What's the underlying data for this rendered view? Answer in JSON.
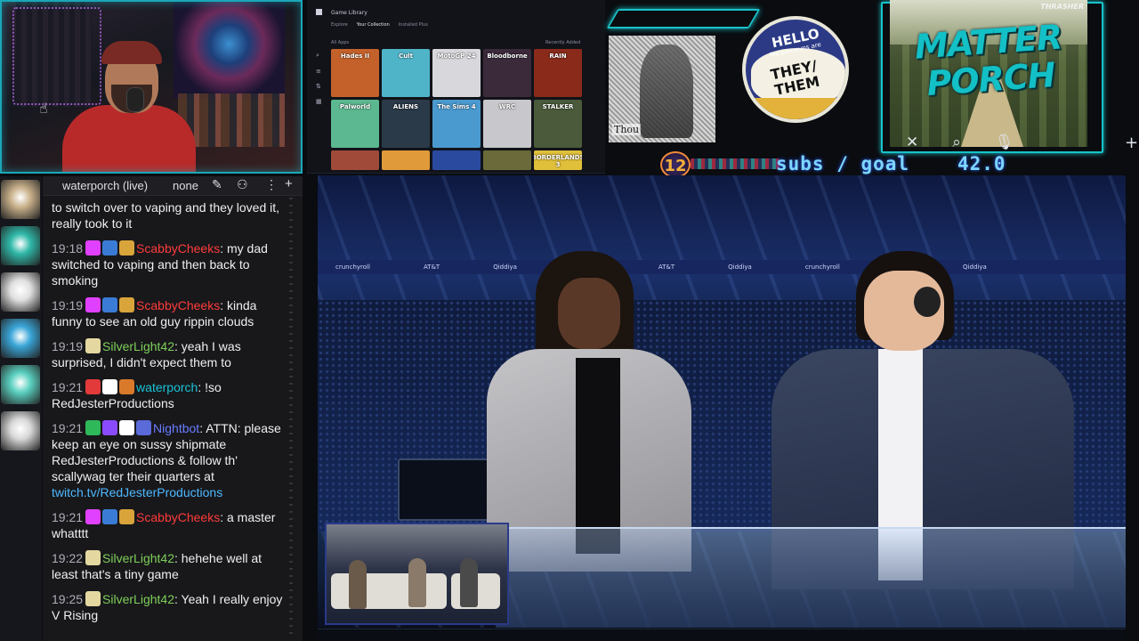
{
  "library": {
    "title": "Game Library",
    "tabs": [
      "Explore",
      "Your Collection",
      "Installed Plus"
    ],
    "all_label": "All Apps",
    "recent_label": "Recently Added",
    "tiles": [
      {
        "label": "Hades II",
        "color": "#c4612a"
      },
      {
        "label": "Cult",
        "color": "#4fb4c8"
      },
      {
        "label": "MotoGP 24",
        "color": "#d8d8dc"
      },
      {
        "label": "Bloodborne",
        "color": "#3a2a3a"
      },
      {
        "label": "RAIN",
        "color": "#8a2a1a"
      },
      {
        "label": "Palworld",
        "color": "#5cb890"
      },
      {
        "label": "ALIENS",
        "color": "#2a3a48"
      },
      {
        "label": "The Sims 4",
        "color": "#4a9ad0"
      },
      {
        "label": "WRC",
        "color": "#c8c8cc"
      },
      {
        "label": "STALKER",
        "color": "#4a5a3a"
      },
      {
        "label": "",
        "color": "#a04a3a"
      },
      {
        "label": "",
        "color": "#e09a3a"
      },
      {
        "label": "",
        "color": "#2a4aa0"
      },
      {
        "label": "",
        "color": "#6a6a3a"
      },
      {
        "label": "BORDERLANDS 3",
        "color": "#e0c03a"
      }
    ]
  },
  "album": {
    "label": "Thou"
  },
  "pronoun": {
    "hello": "HELLO",
    "small": "My pronouns are",
    "pronouns_line1": "THEY/",
    "pronouns_line2": "THEM"
  },
  "logo": {
    "text": "MATTER PORCH",
    "brand": "THRASHER"
  },
  "subs": {
    "count": "12",
    "label": "subs / goal",
    "value": "42.0"
  },
  "chat": {
    "channel": "waterporch (live)",
    "mode": "none",
    "messages": [
      {
        "ts": "",
        "badges": [],
        "user": "",
        "user_color": "#ffffff",
        "text": "to switch over to vaping and they loved it, really took to it"
      },
      {
        "ts": "19:18",
        "badges": [
          "#e040ff",
          "#3a7bd5",
          "#d9a43a"
        ],
        "user": "ScabbyCheeks",
        "user_color": "#ff3b3b",
        "text": "my dad switched to vaping and then back to smoking"
      },
      {
        "ts": "19:19",
        "badges": [
          "#e040ff",
          "#3a7bd5",
          "#d9a43a"
        ],
        "user": "ScabbyCheeks",
        "user_color": "#ff3b3b",
        "text": "kinda funny to see an old guy rippin clouds"
      },
      {
        "ts": "19:19",
        "badges": [
          "#e4d8a0"
        ],
        "user": "SilverLight42",
        "user_color": "#7ecf5a",
        "text": "yeah I was surprised, I didn't expect them to"
      },
      {
        "ts": "19:21",
        "badges": [
          "#e23a3a",
          "#ffffff",
          "#d97a2a"
        ],
        "user": "waterporch",
        "user_color": "#19c3d6",
        "text": "!so RedJesterProductions"
      },
      {
        "ts": "19:21",
        "badges": [
          "#2fb85a",
          "#8a4bff",
          "#ffffff",
          "#5a6ad8"
        ],
        "user": "Nightbot",
        "user_color": "#6a7bff",
        "text": "ATTN: please keep an eye on sussy shipmate RedJesterProductions & follow th' scallywag ter their quarters at",
        "link": "twitch.tv/RedJesterProductions"
      },
      {
        "ts": "19:21",
        "badges": [
          "#e040ff",
          "#3a7bd5",
          "#d9a43a"
        ],
        "user": "ScabbyCheeks",
        "user_color": "#ff3b3b",
        "text": "a master whatttt"
      },
      {
        "ts": "19:22",
        "badges": [
          "#e4d8a0"
        ],
        "user": "SilverLight42",
        "user_color": "#7ecf5a",
        "text": "hehehe well at least that's a tiny game"
      },
      {
        "ts": "19:25",
        "badges": [
          "#e4d8a0"
        ],
        "user": "SilverLight42",
        "user_color": "#7ecf5a",
        "text": "Yeah I really enjoy V Rising"
      }
    ]
  },
  "avatars": [
    "#c8b08a",
    "#2fb8a8",
    "#e0e0e0",
    "#3aa6d8",
    "#5ad0c0",
    "#d8d8d8"
  ],
  "stream": {
    "banner_items": [
      "crunchyroll",
      "AT&T",
      "Qiddiya",
      "crunchyroll",
      "AT&T",
      "Qiddiya",
      "crunchyroll",
      "AT&T",
      "Qiddiya"
    ]
  }
}
